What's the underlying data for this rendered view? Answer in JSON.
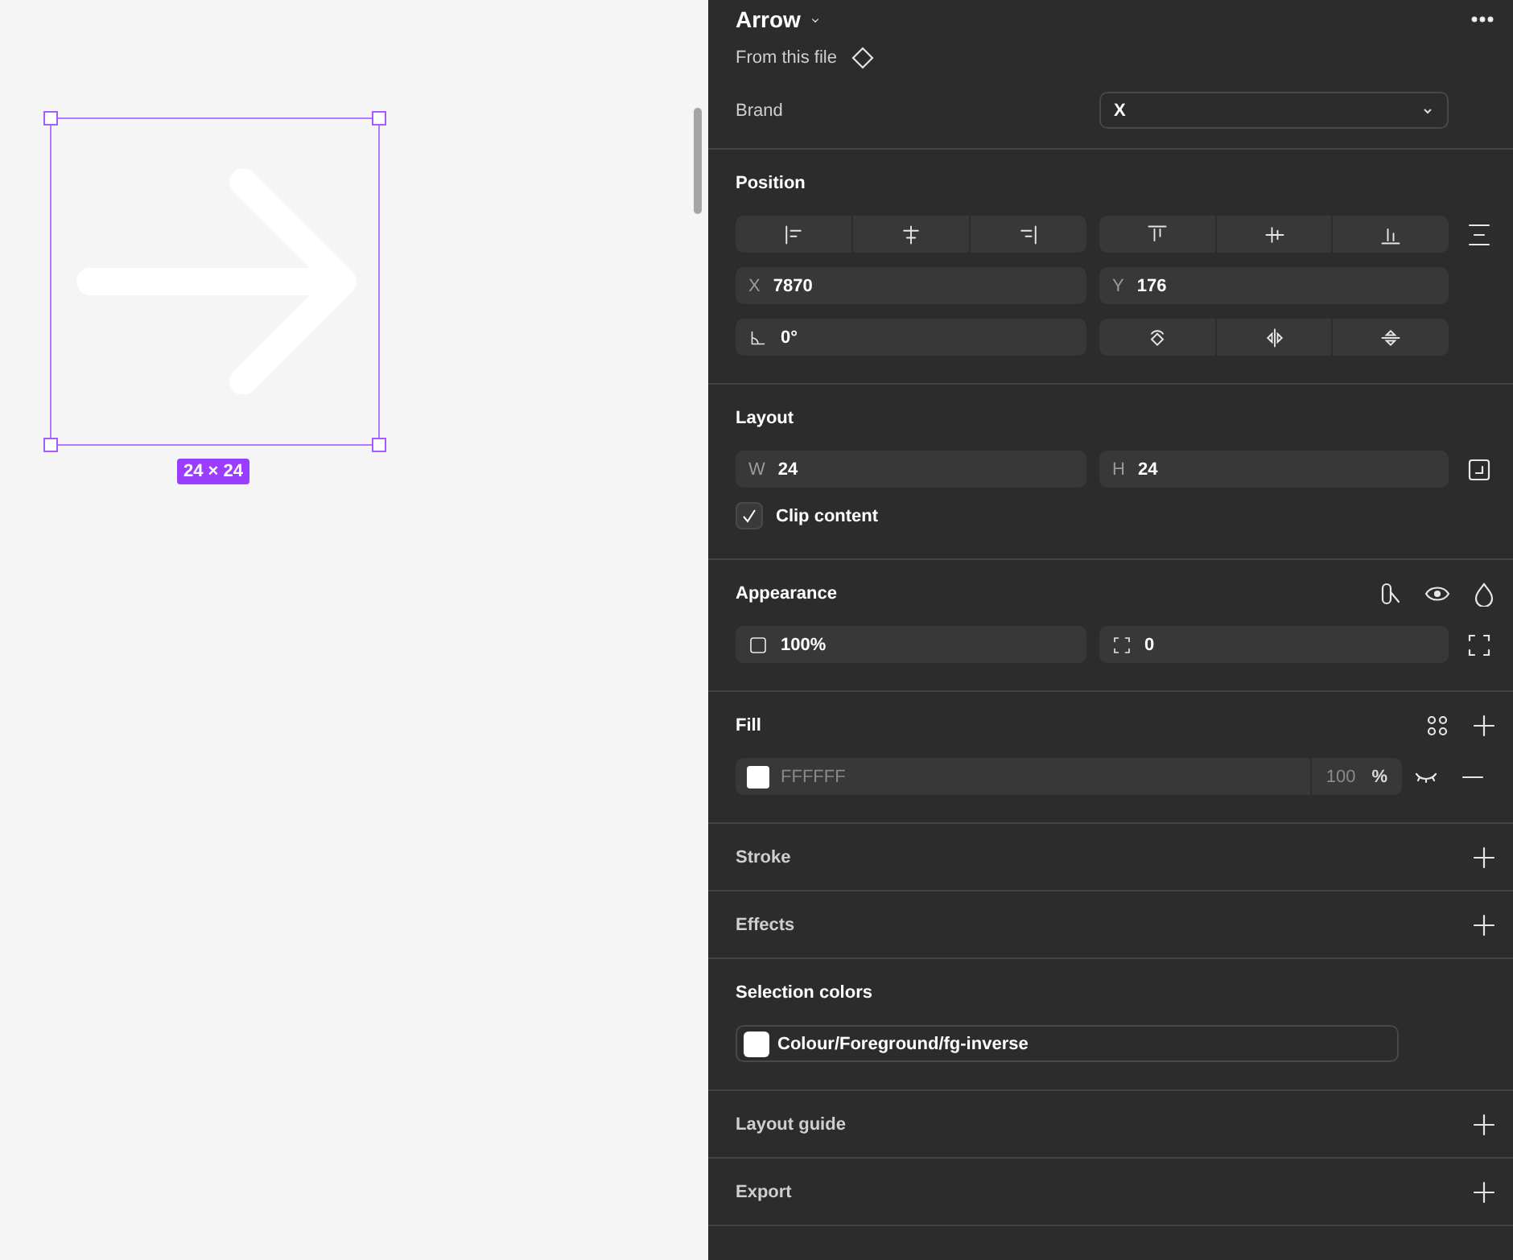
{
  "canvas": {
    "size_badge": "24 × 24"
  },
  "component": {
    "name": "Arrow",
    "source": "From this file",
    "properties": [
      {
        "label": "Brand",
        "value": "X"
      }
    ]
  },
  "sections": [
    {
      "kind": "position",
      "title": "Position",
      "x": {
        "label": "X",
        "value": "7870"
      },
      "y": {
        "label": "Y",
        "value": "176"
      },
      "rotation": "0°"
    },
    {
      "kind": "layout",
      "title": "Layout",
      "width": {
        "label": "W",
        "value": "24"
      },
      "height": {
        "label": "H",
        "value": "24"
      },
      "clip_content": {
        "label": "Clip content",
        "checked": true
      }
    },
    {
      "kind": "appearance",
      "title": "Appearance",
      "opacity": "100%",
      "corner_radius": "0"
    },
    {
      "kind": "fill",
      "title": "Fill",
      "fills": [
        {
          "hex": "FFFFFF",
          "color": "#ffffff",
          "opacity": "100",
          "unit": "%"
        }
      ]
    },
    {
      "kind": "empty",
      "title": "Stroke"
    },
    {
      "kind": "empty",
      "title": "Effects"
    },
    {
      "kind": "selection",
      "title": "Selection colors",
      "colors": [
        {
          "name": "Colour/Foreground/fg-inverse",
          "color": "#ffffff"
        }
      ]
    },
    {
      "kind": "empty",
      "title": "Layout guide"
    },
    {
      "kind": "empty",
      "title": "Export"
    }
  ]
}
